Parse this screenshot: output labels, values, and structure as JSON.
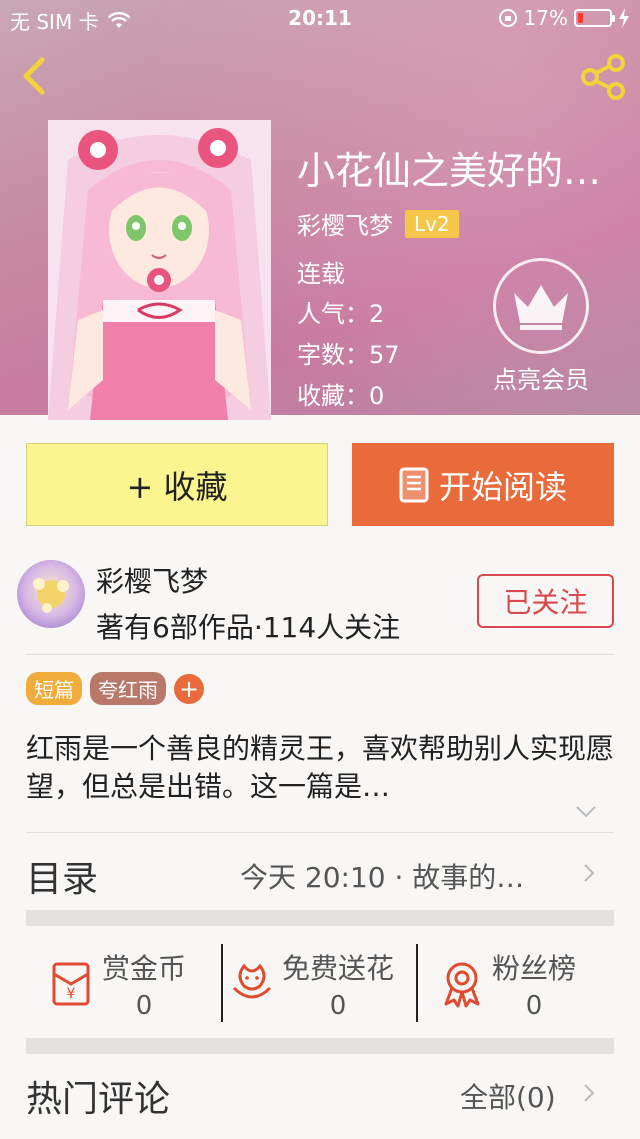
{
  "status_bar": {
    "carrier": "无 SIM 卡",
    "time": "20:11",
    "battery": "17%",
    "battery_level": 0.17
  },
  "book": {
    "title": "小花仙之美好的…",
    "author": "彩樱飞梦",
    "level": "Lv2",
    "status": "连载",
    "popularity": "人气：2",
    "word_count": "字数：57",
    "favorites": "收藏：0"
  },
  "vip": {
    "label": "点亮会员"
  },
  "actions": {
    "collect": "+ 收藏",
    "read": "开始阅读"
  },
  "author_card": {
    "name": "彩樱飞梦",
    "stats": "著有6部作品·114人关注",
    "follow": "已关注"
  },
  "tags": [
    {
      "label": "短篇",
      "color": "#f0ad3b"
    },
    {
      "label": "夸红雨",
      "color": "#b8796a"
    }
  ],
  "tag_add": "+",
  "description": "红雨是一个善良的精灵王，喜欢帮助别人实现愿望，但总是出错。这一篇是…",
  "catalog": {
    "title": "目录",
    "latest": "今天 20:10 · 故事的…"
  },
  "rewards": [
    {
      "name": "赏金币",
      "count": "0",
      "icon": "red-envelope-icon"
    },
    {
      "name": "免费送花",
      "count": "0",
      "icon": "flower-icon"
    },
    {
      "name": "粉丝榜",
      "count": "0",
      "icon": "medal-icon"
    }
  ],
  "comments": {
    "title": "热门评论",
    "all": "全部(0)"
  },
  "colors": {
    "accent": "#e96b3c",
    "collect_bg": "#fbf58f",
    "follow": "#d7494c",
    "level_badge": "#f6c64a"
  }
}
